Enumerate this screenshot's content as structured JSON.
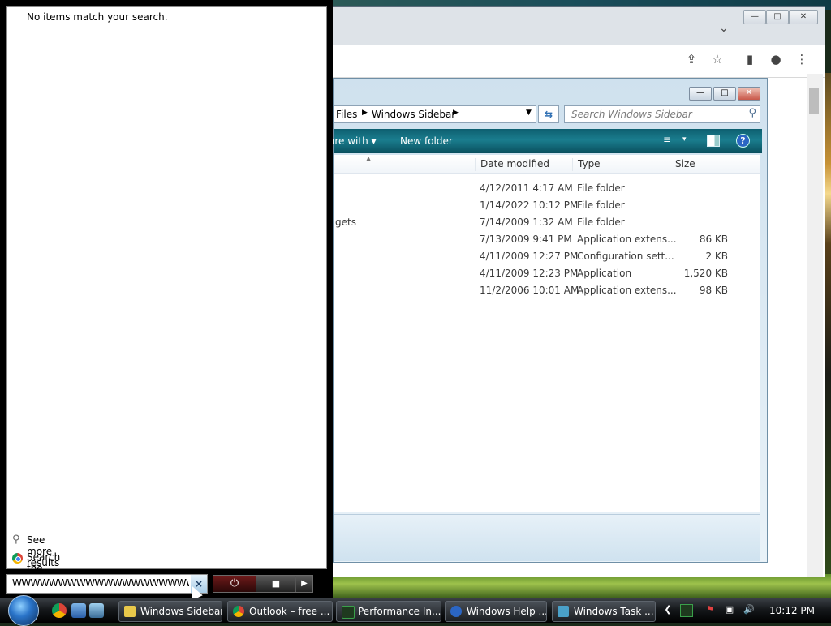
{
  "start_menu": {
    "no_results": "No items match your search.",
    "see_more": "See more results",
    "search_internet": "Search the Internet",
    "search_value": "WWWWWWWWWWWWWWWWWWWWWWWW",
    "clear_label": "×",
    "power_glyph": "⏻",
    "lock_glyph": "🔒",
    "arrow_glyph": "▶"
  },
  "chrome": {
    "min": "—",
    "max": "□",
    "close": "✕",
    "chevron": "⌄",
    "icons": [
      "share-icon",
      "star-icon",
      "sidepanel-icon",
      "profile-icon",
      "menu-icon"
    ]
  },
  "explorer": {
    "min": "—",
    "max": "□",
    "close": "✕",
    "address": {
      "part1": "Files",
      "part2": "Windows Sidebar",
      "sep": "▶",
      "dropdown": "▼"
    },
    "refresh": "⇆",
    "search_placeholder": "Search Windows Sidebar",
    "commands": {
      "share_with": "are with ▾",
      "new_folder": "New folder",
      "views": "≡",
      "views_dd": "▾",
      "help": "?"
    },
    "columns": {
      "date": "Date modified",
      "type": "Type",
      "size": "Size"
    },
    "rows": [
      {
        "name": "",
        "date": "4/12/2011 4:17 AM",
        "type": "File folder",
        "size": ""
      },
      {
        "name": "",
        "date": "1/14/2022 10:12 PM",
        "type": "File folder",
        "size": ""
      },
      {
        "name": "gets",
        "date": "7/14/2009 1:32 AM",
        "type": "File folder",
        "size": ""
      },
      {
        "name": "",
        "date": "7/13/2009 9:41 PM",
        "type": "Application extens...",
        "size": "86 KB"
      },
      {
        "name": "",
        "date": "4/11/2009 12:27 PM",
        "type": "Configuration sett...",
        "size": "2 KB"
      },
      {
        "name": "",
        "date": "4/11/2009 12:23 PM",
        "type": "Application",
        "size": "1,520 KB"
      },
      {
        "name": "",
        "date": "11/2/2006 10:01 AM",
        "type": "Application extens...",
        "size": "98 KB"
      }
    ]
  },
  "taskbar": {
    "tasks": [
      {
        "label": "Windows Sidebar",
        "icon_color": "#e8c84a"
      },
      {
        "label": "Outlook – free ...",
        "icon_color": "#3b8ee0"
      },
      {
        "label": "Performance In...",
        "icon_color": "#3aa04a"
      },
      {
        "label": "Windows Help ...",
        "icon_color": "#2b66c4"
      },
      {
        "label": "Windows Task ...",
        "icon_color": "#4aa0c8"
      }
    ],
    "tray": {
      "collapse": "❮",
      "volume": "🔊",
      "clock": "10:12 PM"
    }
  }
}
